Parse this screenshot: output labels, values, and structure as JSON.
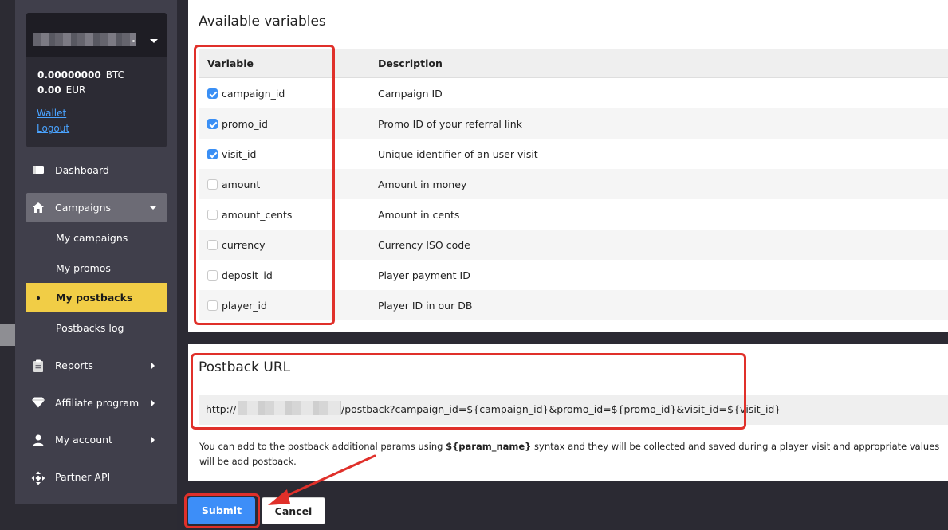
{
  "account": {
    "btc_amount": "0.00000000",
    "btc_currency": "BTC",
    "eur_amount": "0.00",
    "eur_currency": "EUR",
    "wallet_link": "Wallet",
    "logout_link": "Logout"
  },
  "nav": {
    "dashboard": "Dashboard",
    "campaigns": "Campaigns",
    "sub": {
      "my_campaigns": "My campaigns",
      "my_promos": "My promos",
      "my_postbacks": "My postbacks",
      "postbacks_log": "Postbacks log"
    },
    "reports": "Reports",
    "affiliate_program": "Affiliate program",
    "my_account": "My account",
    "partner_api": "Partner API"
  },
  "variables": {
    "title": "Available variables",
    "col_variable": "Variable",
    "col_description": "Description",
    "rows": [
      {
        "name": "campaign_id",
        "desc": "Campaign ID",
        "checked": true
      },
      {
        "name": "promo_id",
        "desc": "Promo ID of your referral link",
        "checked": true
      },
      {
        "name": "visit_id",
        "desc": "Unique identifier of an user visit",
        "checked": true
      },
      {
        "name": "amount",
        "desc": "Amount in money",
        "checked": false
      },
      {
        "name": "amount_cents",
        "desc": "Amount in cents",
        "checked": false
      },
      {
        "name": "currency",
        "desc": "Currency ISO code",
        "checked": false
      },
      {
        "name": "deposit_id",
        "desc": "Player payment ID",
        "checked": false
      },
      {
        "name": "player_id",
        "desc": "Player ID in our DB",
        "checked": false
      }
    ]
  },
  "postback": {
    "title": "Postback URL",
    "url_prefix": "http://",
    "url_path": "/postback?campaign_id=${campaign_id}&promo_id=${promo_id}&visit_id=${visit_id}",
    "help_before": "You can add to the postback additional params using ",
    "help_param": "${param_name}",
    "help_after": " syntax and they will be collected and saved during a player visit and appropriate values will be add postback."
  },
  "buttons": {
    "submit": "Submit",
    "cancel": "Cancel"
  },
  "colors": {
    "accent": "#3d8ef8",
    "active_nav": "#f1cd46",
    "annotation": "#e0302a"
  }
}
